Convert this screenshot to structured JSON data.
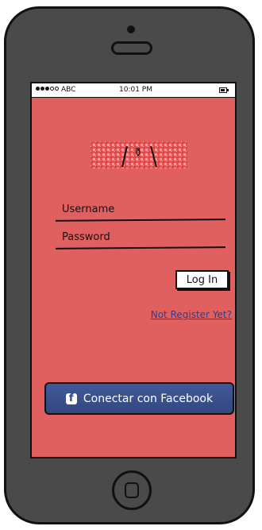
{
  "status_bar": {
    "carrier": "ABC",
    "time": "10:01 PM",
    "signal_icon": "signal-dots-icon",
    "battery_icon": "battery-icon"
  },
  "logo": {
    "icon": "tablecloth-cutlery-logo",
    "color": "#e03c3c"
  },
  "login_form": {
    "username_placeholder": "Username",
    "password_placeholder": "Password",
    "login_button": "Log In",
    "register_link": "Not Register Yet?"
  },
  "facebook": {
    "button_label": "Conectar con Facebook",
    "icon": "facebook-icon",
    "color": "#3b5998"
  },
  "colors": {
    "screen_background": "#e06060",
    "phone_body": "#4a4a4a",
    "link": "#2a3f8f"
  }
}
